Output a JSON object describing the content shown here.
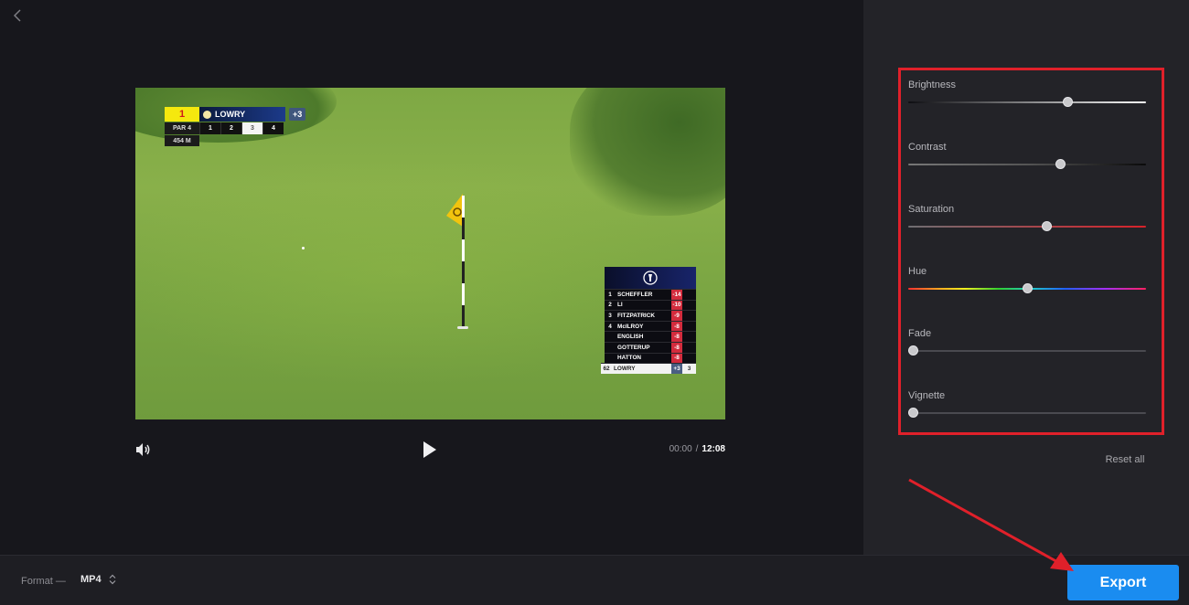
{
  "player": {
    "current_time": "00:00",
    "separator": "/",
    "duration": "12:08"
  },
  "scorebug": {
    "hole": "1",
    "player_name": "LOWRY",
    "to_par": "+3",
    "par": "PAR 4",
    "holes": [
      "1",
      "2",
      "3",
      "4"
    ],
    "active_hole_index": 2,
    "distance": "454 M"
  },
  "leaderboard": {
    "rows": [
      {
        "pos": "1",
        "name": "SCHEFFLER",
        "score": "-14"
      },
      {
        "pos": "2",
        "name": "LI",
        "score": "-10"
      },
      {
        "pos": "3",
        "name": "FITZPATRICK",
        "score": "-9"
      },
      {
        "pos": "4",
        "name": "McILROY",
        "score": "-8"
      },
      {
        "pos": "",
        "name": "ENGLISH",
        "score": "-8"
      },
      {
        "pos": "",
        "name": "GOTTERUP",
        "score": "-8"
      },
      {
        "pos": "",
        "name": "HATTON",
        "score": "-8"
      }
    ],
    "me": {
      "pos": "62",
      "name": "LOWRY",
      "score": "+3",
      "thru": "3"
    }
  },
  "adjustments": {
    "sliders": [
      {
        "label": "Brightness",
        "value": 0.68
      },
      {
        "label": "Contrast",
        "value": 0.645
      },
      {
        "label": "Saturation",
        "value": 0.588
      },
      {
        "label": "Hue",
        "value": 0.5
      },
      {
        "label": "Fade",
        "value": 0.0
      },
      {
        "label": "Vignette",
        "value": 0.0
      }
    ],
    "reset_label": "Reset all"
  },
  "bottom_bar": {
    "format_label": "Format —",
    "format_value": "MP4",
    "export_label": "Export"
  },
  "colors": {
    "accent": "#1a8cf0",
    "highlight": "#e0202a"
  },
  "icons": {
    "back": "chevron-left-icon",
    "volume": "speaker-icon",
    "play": "play-icon",
    "format": "updown-chevron-icon"
  }
}
